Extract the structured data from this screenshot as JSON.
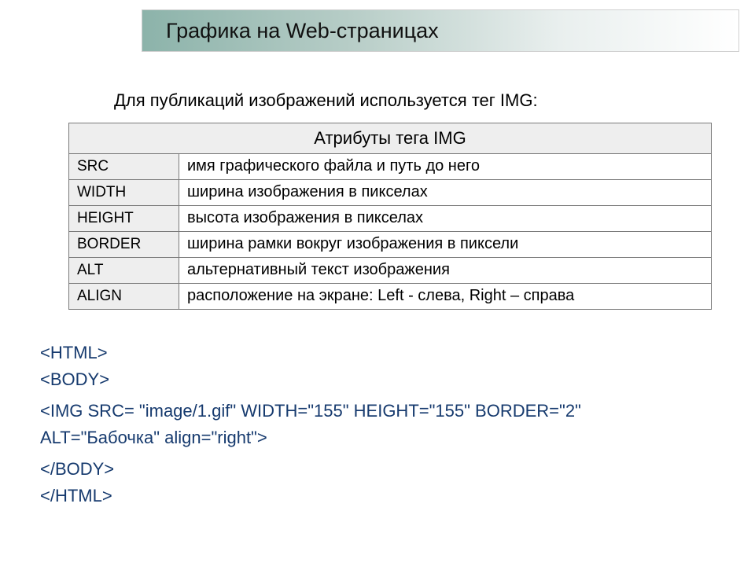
{
  "banner": {
    "title": "Графика на Web-страницах"
  },
  "intro": "Для публикаций изображений используется тег IMG:",
  "table": {
    "header": "Атрибуты тега IMG",
    "rows": [
      {
        "attr": "SRC",
        "desc": "имя графического файла и путь до него"
      },
      {
        "attr": "WIDTH",
        "desc": "ширина изображения в пикселах"
      },
      {
        "attr": "HEIGHT",
        "desc": "высота изображения в пикселах"
      },
      {
        "attr": "BORDER",
        "desc": "ширина рамки вокруг изображения в пиксели"
      },
      {
        "attr": "ALT",
        "desc": "альтернативный текст изображения"
      },
      {
        "attr": "ALIGN",
        "desc": "расположение на экране: Left - слева, Right – справа"
      }
    ]
  },
  "code": {
    "l1": "<HTML>",
    "l2": "<BODY>",
    "l3": "<IMG SRC= \"image/1.gif\" WIDTH=\"155\" HEIGHT=\"155\" BORDER=\"2\"",
    "l4": "ALT=\"Бабочка\" align=\"right\">",
    "l5": "</BODY>",
    "l6": "</HTML>"
  }
}
